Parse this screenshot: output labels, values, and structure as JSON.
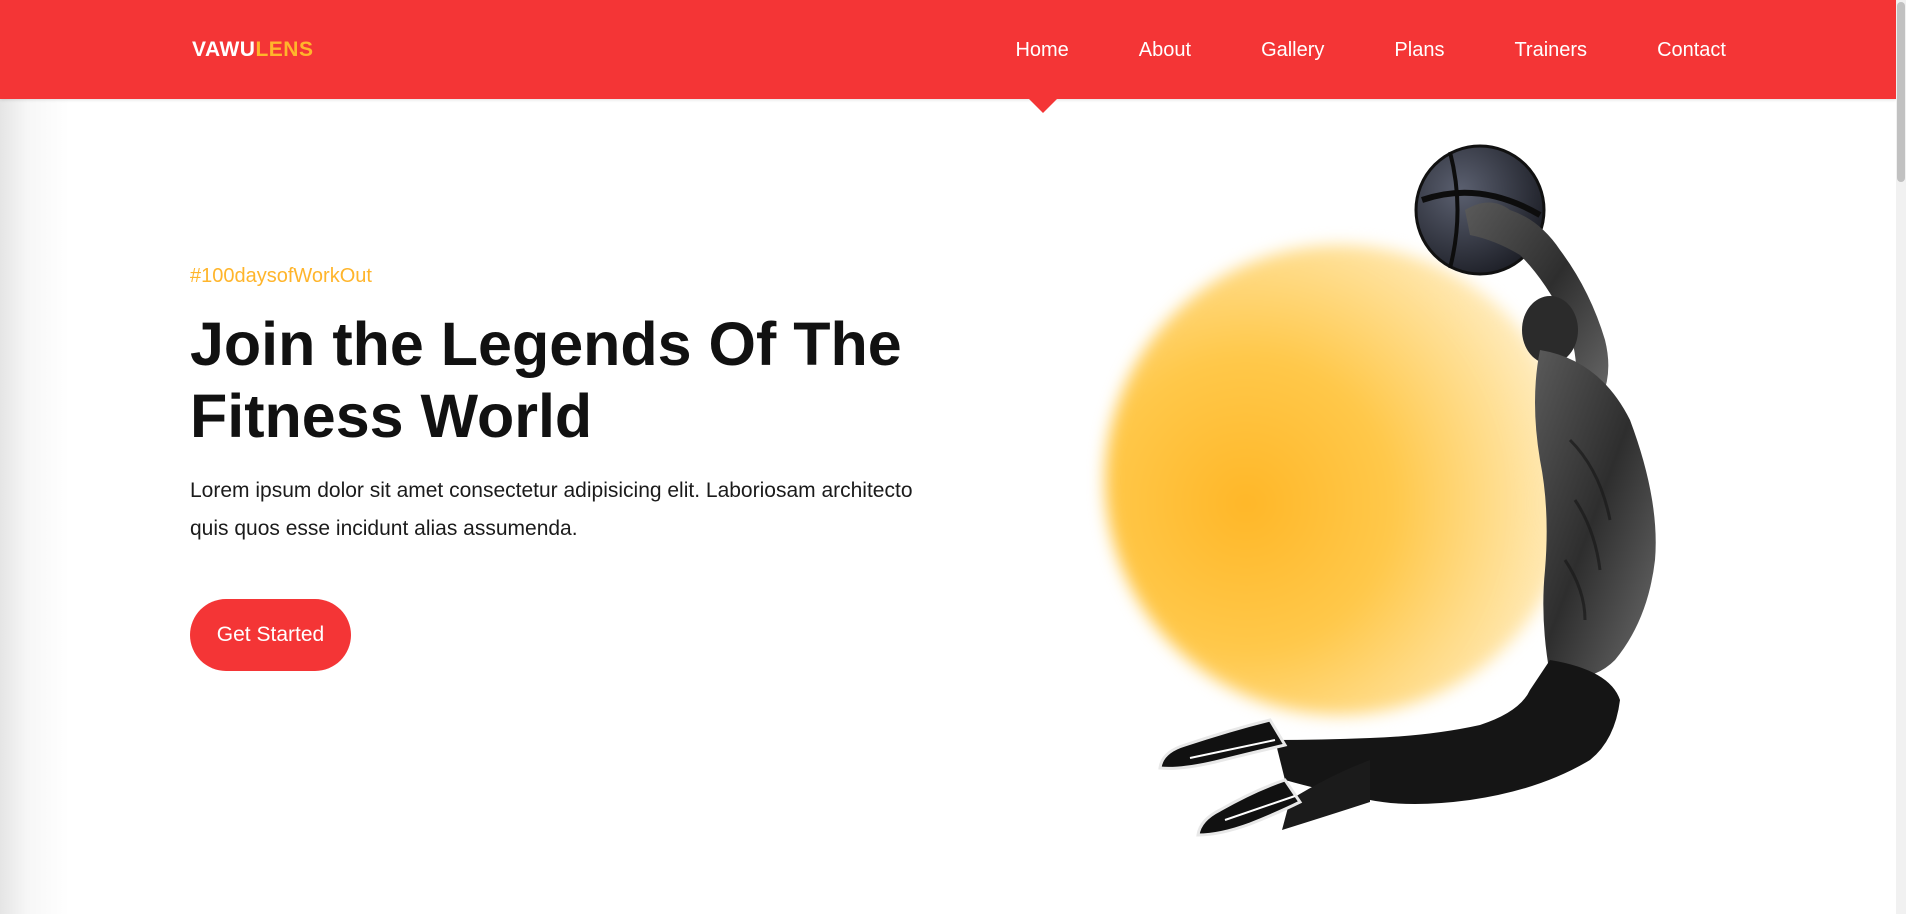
{
  "brand": {
    "part1": "VAWU",
    "part2": "LENS"
  },
  "nav": {
    "items": [
      "Home",
      "About",
      "Gallery",
      "Plans",
      "Trainers",
      "Contact"
    ],
    "active": "Home"
  },
  "hero": {
    "tag": "#100daysofWorkOut",
    "headline": "Join the Legends Of The Fitness World",
    "description": "Lorem ipsum dolor sit amet consectetur adipisicing elit. Laboriosam architecto quis quos esse incidunt alias assumenda.",
    "cta_label": "Get Started"
  },
  "colors": {
    "primary": "#f43536",
    "accent": "#ffb52b",
    "text": "#111111",
    "background": "#ffffff"
  }
}
